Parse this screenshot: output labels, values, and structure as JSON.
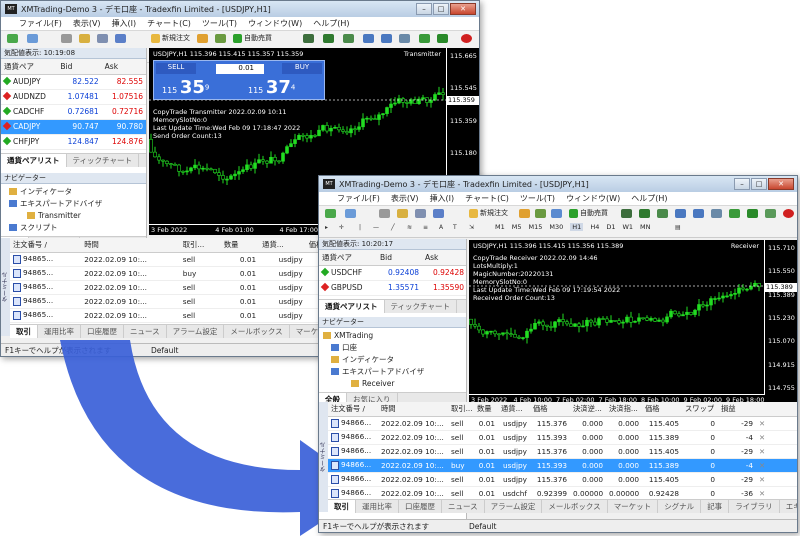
{
  "back": {
    "title": "XMTrading-Demo 3 - デモ口座 - Tradexfin Limited - [USDJPY,H1]",
    "menu": [
      "ファイル(F)",
      "表示(V)",
      "挿入(I)",
      "チャート(C)",
      "ツール(T)",
      "ウィンドウ(W)",
      "ヘルプ(H)"
    ],
    "new_order": "新規注文",
    "auto_trade": "自動売買",
    "market_watch_title": "気配値表示: 10:19:08",
    "mw_headers": [
      "通貨ペア",
      "Bid",
      "Ask"
    ],
    "mw_rows": [
      [
        "AUDJPY",
        "82.522",
        "82.555"
      ],
      [
        "AUDNZD",
        "1.07481",
        "1.07516"
      ],
      [
        "CADCHF",
        "0.72681",
        "0.72716"
      ],
      [
        "CADJPY",
        "90.747",
        "90.780"
      ],
      [
        "CHFJPY",
        "124.847",
        "124.876"
      ]
    ],
    "mw_tabs": [
      "通貨ペアリスト",
      "ティックチャート"
    ],
    "nav_title": "ナビゲーター",
    "nav_items": [
      "インディケータ",
      "エキスパートアドバイザ",
      "Transmitter",
      "スクリプト"
    ],
    "nav_tabs": [
      "全般",
      "お気に入り"
    ],
    "chart_header": "USDJPY,H1  115.396 115.415 115.357 115.359",
    "chart_label": "Transmitter",
    "trade_panel": {
      "sell": "SELL",
      "buy": "BUY",
      "lot": "0.01",
      "sell_big": "35",
      "sell_small": "115",
      "sell_sup": "9",
      "buy_big": "37",
      "buy_small": "115",
      "buy_sup": "4"
    },
    "chart_text": [
      "CopyTrade Transmitter 2022.02.09 10:11",
      "MemorySlotNo:0",
      "Last Update Time:Wed Feb 09 17:18:47 2022",
      "Send Order Count:13"
    ],
    "y_ticks": [
      "115.665",
      "115.545",
      "115.359",
      "115.180",
      "115.060",
      "114.920"
    ],
    "price_label": "115.359",
    "x_ticks": [
      "3 Feb 2022",
      "4 Feb 01:00",
      "4 Feb 17:00",
      "7 Feb 09:00",
      "8 Feb 01:00"
    ],
    "term_headers": [
      "注文番号 /",
      "時間",
      "取引...",
      "数量",
      "通貨...",
      "価格",
      "決済逆...",
      "決済指..."
    ],
    "term_rows": [
      [
        "94865...",
        "2022.02.09 10:...",
        "sell",
        "0.01",
        "usdjpy",
        "115.404",
        "0.000",
        "0.000"
      ],
      [
        "94865...",
        "2022.02.09 10:...",
        "buy",
        "0.01",
        "usdjpy",
        "115.421",
        "0.000",
        "0.000"
      ],
      [
        "94865...",
        "2022.02.09 10:...",
        "sell",
        "0.01",
        "usdjpy",
        "115.386",
        "0.000",
        "0.000"
      ],
      [
        "94865...",
        "2022.02.09 10:...",
        "sell",
        "0.01",
        "usdjpy",
        "115.400",
        "0.000",
        "0.000"
      ],
      [
        "94865...",
        "2022.02.09 10:...",
        "sell",
        "0.01",
        "usdjpy",
        "115.393",
        "0.000",
        "0.000"
      ]
    ],
    "term_tabs": [
      "取引",
      "運用比率",
      "口座履歴",
      "ニュース",
      "アラーム設定",
      "メールボックス",
      "マーケット"
    ],
    "status": "F1キーでヘルプが表示されます",
    "status_right": "Default",
    "vtab": "ターミナル"
  },
  "front": {
    "title": "XMTrading-Demo 3 - デモ口座 - Tradexfin Limited - [USDJPY,H1]",
    "menu": [
      "ファイル(F)",
      "表示(V)",
      "挿入(I)",
      "チャート(C)",
      "ツール(T)",
      "ウィンドウ(W)",
      "ヘルプ(H)"
    ],
    "new_order": "新規注文",
    "auto_trade": "自動売買",
    "timeframes": [
      "M1",
      "M5",
      "M15",
      "M30",
      "H1",
      "H4",
      "D1",
      "W1",
      "MN"
    ],
    "market_watch_title": "気配値表示: 10:20:17",
    "mw_headers": [
      "通貨ペア",
      "Bid",
      "Ask"
    ],
    "mw_rows": [
      [
        "USDCHF",
        "0.92408",
        "0.92428"
      ],
      [
        "GBPUSD",
        "1.35571",
        "1.35590"
      ]
    ],
    "mw_tabs": [
      "通貨ペアリスト",
      "ティックチャート"
    ],
    "nav_title": "ナビゲーター",
    "nav_items": [
      "XMTrading",
      "口座",
      "インディケータ",
      "エキスパートアドバイザ",
      "Receiver"
    ],
    "nav_tabs": [
      "全般",
      "お気に入り"
    ],
    "chart_header": "USDJPY,H1  115.396 115.415 115.356 115.389",
    "chart_label": "Receiver",
    "chart_text": [
      "CopyTrade Receiver 2022.02.09 14:46",
      "LotsMultiply:1",
      "MagicNumber:20220131",
      "MemorySlotNo:0",
      "Last Update Time:Wed Feb 09 17:19:54 2022",
      "Received Order Count:13"
    ],
    "y_ticks": [
      "115.710",
      "115.550",
      "115.389",
      "115.230",
      "115.070",
      "114.915",
      "114.755"
    ],
    "price_label": "115.389",
    "x_ticks": [
      "3 Feb 2022",
      "4 Feb 10:00",
      "7 Feb 02:00",
      "7 Feb 18:00",
      "8 Feb 10:00",
      "9 Feb 02:00",
      "9 Feb 18:00"
    ],
    "term_headers": [
      "注文番号 /",
      "時間",
      "取引...",
      "数量",
      "通貨...",
      "価格",
      "決済逆...",
      "決済指...",
      "価格",
      "スワップ",
      "損益"
    ],
    "term_rows": [
      [
        "94866...",
        "2022.02.09 10:...",
        "sell",
        "0.01",
        "usdjpy",
        "115.376",
        "0.000",
        "0.000",
        "115.405",
        "0",
        "-29"
      ],
      [
        "94866...",
        "2022.02.09 10:...",
        "sell",
        "0.01",
        "usdjpy",
        "115.393",
        "0.000",
        "0.000",
        "115.389",
        "0",
        "-4"
      ],
      [
        "94866...",
        "2022.02.09 10:...",
        "sell",
        "0.01",
        "usdjpy",
        "115.376",
        "0.000",
        "0.000",
        "115.405",
        "0",
        "-29"
      ],
      [
        "94866...",
        "2022.02.09 10:...",
        "buy",
        "0.01",
        "usdjpy",
        "115.393",
        "0.000",
        "0.000",
        "115.389",
        "0",
        "-4"
      ],
      [
        "94866...",
        "2022.02.09 10:...",
        "sell",
        "0.01",
        "usdjpy",
        "115.376",
        "0.000",
        "0.000",
        "115.405",
        "0",
        "-29"
      ],
      [
        "94866...",
        "2022.02.09 10:...",
        "sell",
        "0.01",
        "usdchf",
        "0.92399",
        "0.00000",
        "0.00000",
        "0.92428",
        "0",
        "-36"
      ]
    ],
    "term_tabs": [
      "取引",
      "運用比率",
      "口座履歴",
      "ニュース",
      "アラーム設定",
      "メールボックス",
      "マーケット",
      "シグナル",
      "記事",
      "ライブラリ",
      "エキ"
    ],
    "mail_badge": "6",
    "status": "F1キーでヘルプが表示されます",
    "status_right": "Default",
    "vtab": "ターミナル"
  },
  "colors": {
    "arrow": "#3a5fd8",
    "candle": "#22dd22",
    "chart_bg": "#000000",
    "bid": "#0a3fd6",
    "ask": "#dd0000",
    "select": "#3399ff"
  }
}
